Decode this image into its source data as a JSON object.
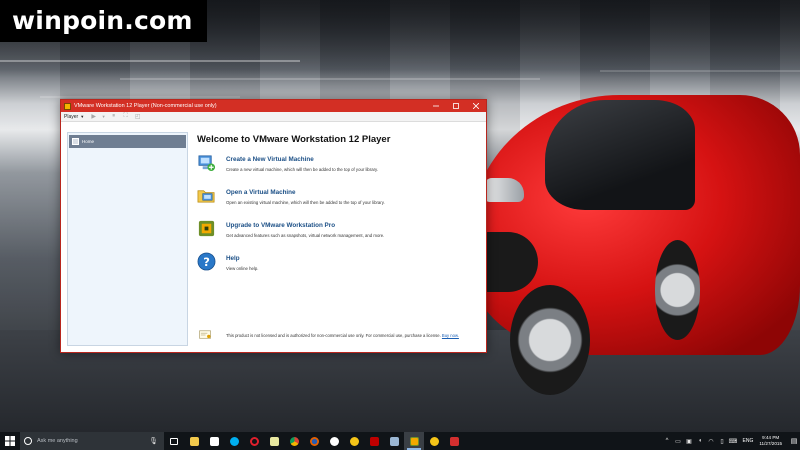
{
  "site": {
    "logo_text": "winpoin.com"
  },
  "window": {
    "title": "VMware Workstation 12 Player (Non-commercial use only)",
    "controls": [
      "minimize",
      "maximize",
      "close"
    ],
    "accent_color": "#d32f24"
  },
  "toolbar": {
    "player_menu_label": "Player",
    "icons": [
      "play-icon",
      "dropdown-caret-icon",
      "suspend-icon",
      "fullscreen-icon",
      "unity-icon"
    ]
  },
  "sidebar": {
    "items": [
      {
        "label": "Home",
        "icon": "home-icon",
        "selected": true
      }
    ]
  },
  "main": {
    "welcome_title": "Welcome to VMware Workstation 12 Player",
    "actions": [
      {
        "icon": "create-vm-icon",
        "title": "Create a New Virtual Machine",
        "description": "Create a new virtual machine, which will then be added to the top of your library."
      },
      {
        "icon": "open-folder-icon",
        "title": "Open a Virtual Machine",
        "description": "Open an existing virtual machine, which will then be added to the top of your library."
      },
      {
        "icon": "upgrade-icon",
        "title": "Upgrade to VMware Workstation Pro",
        "description": "Get advanced features such as snapshots, virtual network management, and more."
      },
      {
        "icon": "help-icon",
        "title": "Help",
        "description": "View online help."
      }
    ],
    "license": {
      "text": "This product is not licensed and is authorized for non-commercial use only. For commercial use, purchase a license. ",
      "link": "Buy now."
    }
  },
  "taskbar": {
    "search_placeholder": "Ask me anything",
    "apps": [
      "task-view-icon",
      "file-explorer-icon",
      "store-icon",
      "skype-icon",
      "opera-icon",
      "notepad-icon",
      "chrome-icon",
      "firefox-icon",
      "steam-icon",
      "emoji-icon",
      "filezilla-icon",
      "network-tool-icon",
      "vmware-icon",
      "app-icon",
      "cancel-app-icon"
    ],
    "active_app": "vmware-icon",
    "language": "ENG",
    "time": "9:44 PM",
    "date": "11/27/2015"
  }
}
